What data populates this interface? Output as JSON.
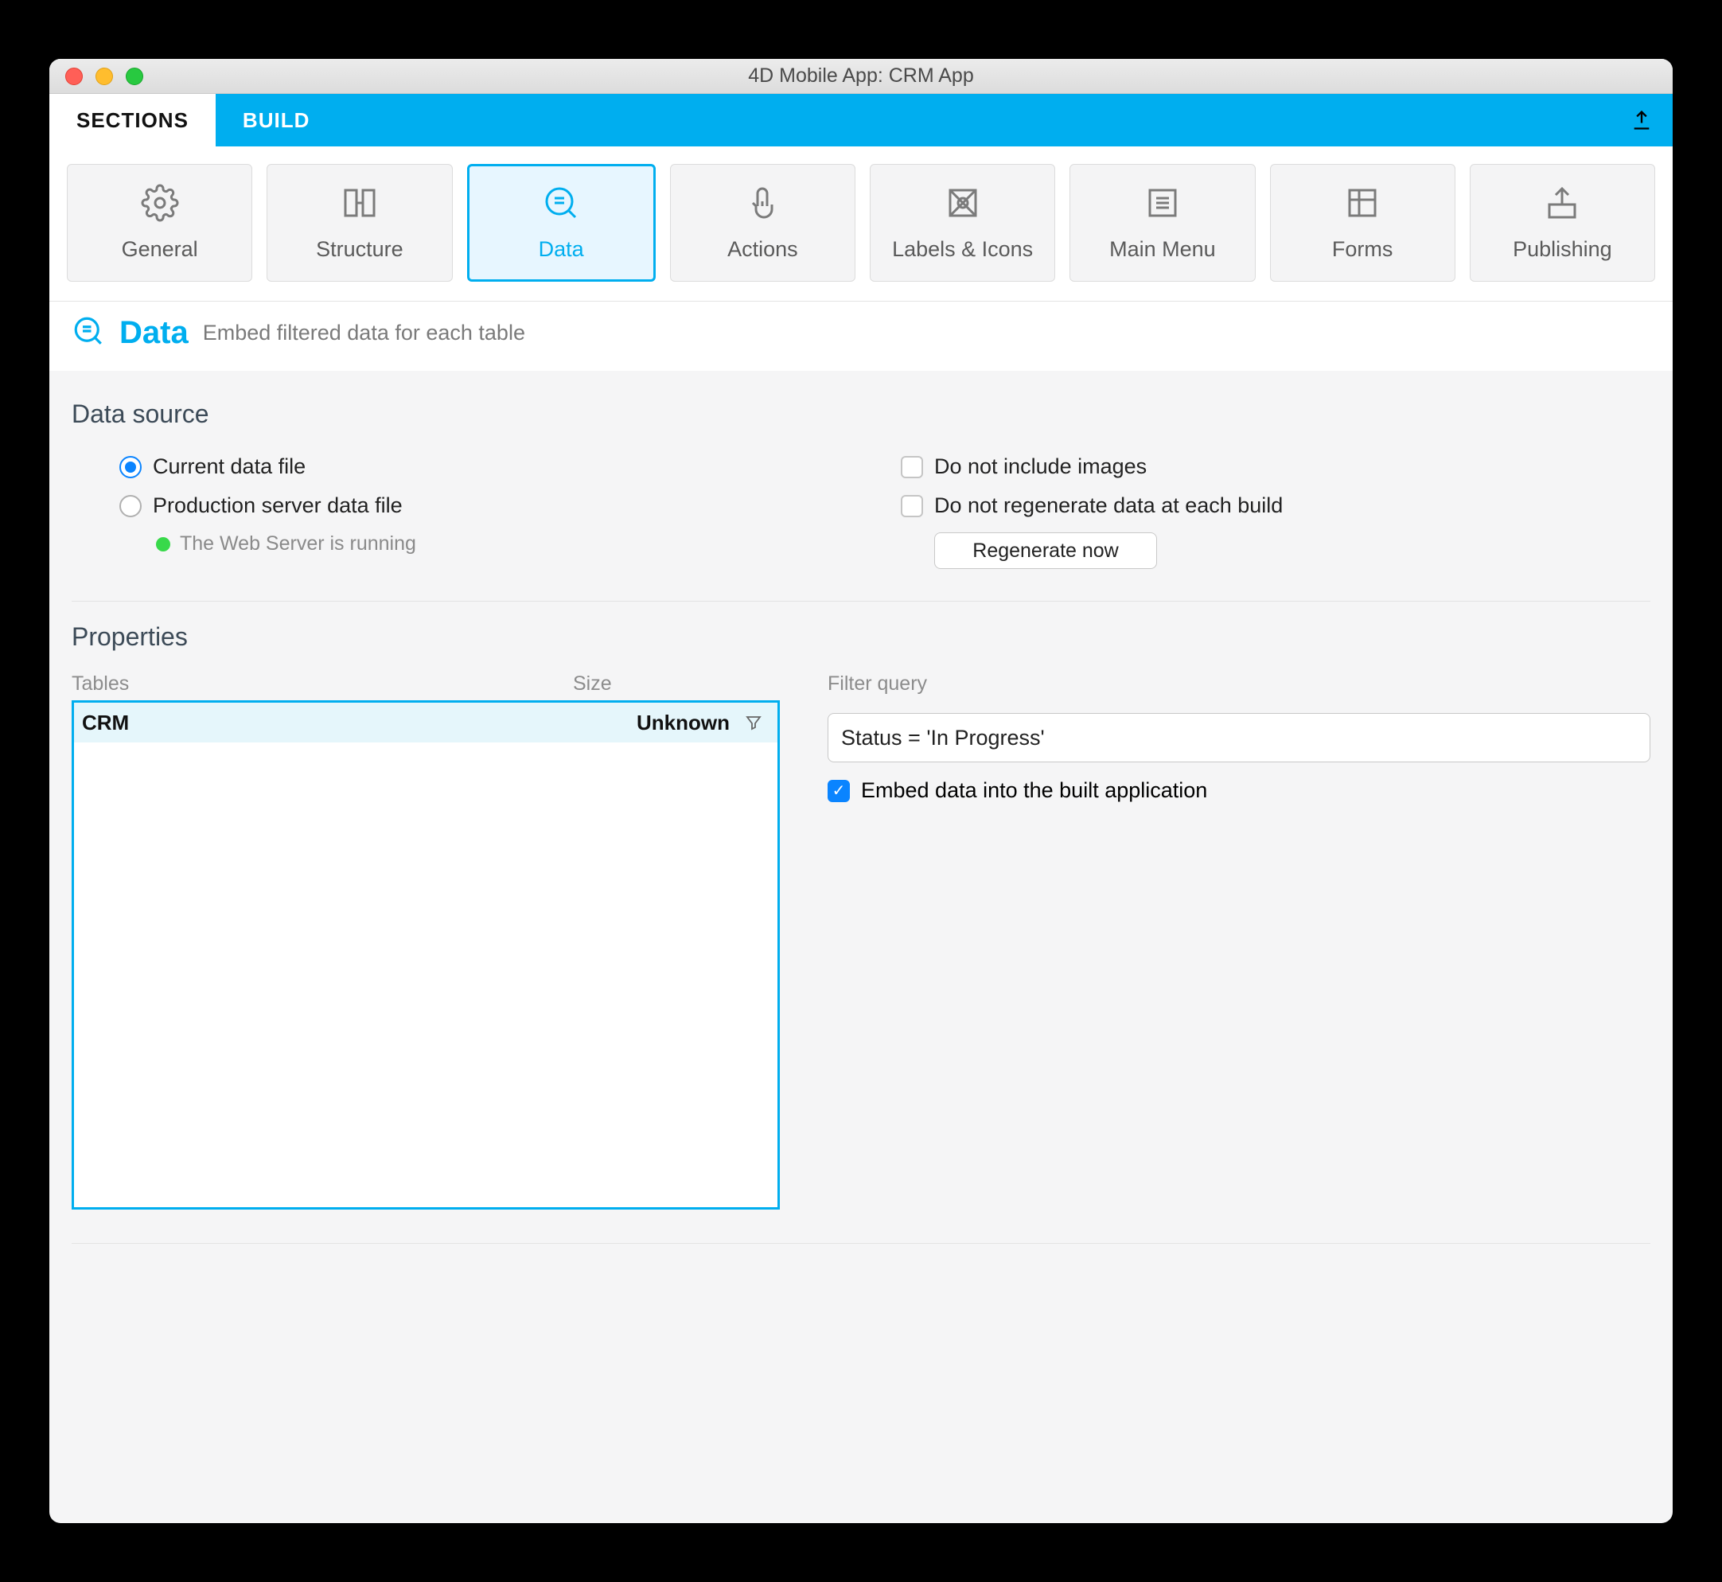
{
  "window_title": "4D Mobile App: CRM App",
  "tabs": {
    "sections": "SECTIONS",
    "build": "BUILD"
  },
  "section_tabs": [
    {
      "id": "general",
      "label": "General"
    },
    {
      "id": "structure",
      "label": "Structure"
    },
    {
      "id": "data",
      "label": "Data"
    },
    {
      "id": "actions",
      "label": "Actions"
    },
    {
      "id": "labels",
      "label": "Labels & Icons"
    },
    {
      "id": "mainmenu",
      "label": "Main Menu"
    },
    {
      "id": "forms",
      "label": "Forms"
    },
    {
      "id": "publishing",
      "label": "Publishing"
    }
  ],
  "page": {
    "title": "Data",
    "subtitle": "Embed filtered data for each table"
  },
  "data_source": {
    "heading": "Data source",
    "current_label": "Current data file",
    "production_label": "Production server data file",
    "server_status": "The Web Server is running",
    "no_images_label": "Do not include images",
    "no_regen_label": "Do not regenerate data at each build",
    "regen_button": "Regenerate now",
    "selected": "current",
    "no_images": false,
    "no_regen": false
  },
  "properties": {
    "heading": "Properties",
    "tables_label": "Tables",
    "size_label": "Size",
    "rows": [
      {
        "name": "CRM",
        "size": "Unknown"
      }
    ],
    "filter_label": "Filter query",
    "filter_value": "Status = 'In Progress'",
    "embed_label": "Embed data into the built application",
    "embed_checked": true
  }
}
